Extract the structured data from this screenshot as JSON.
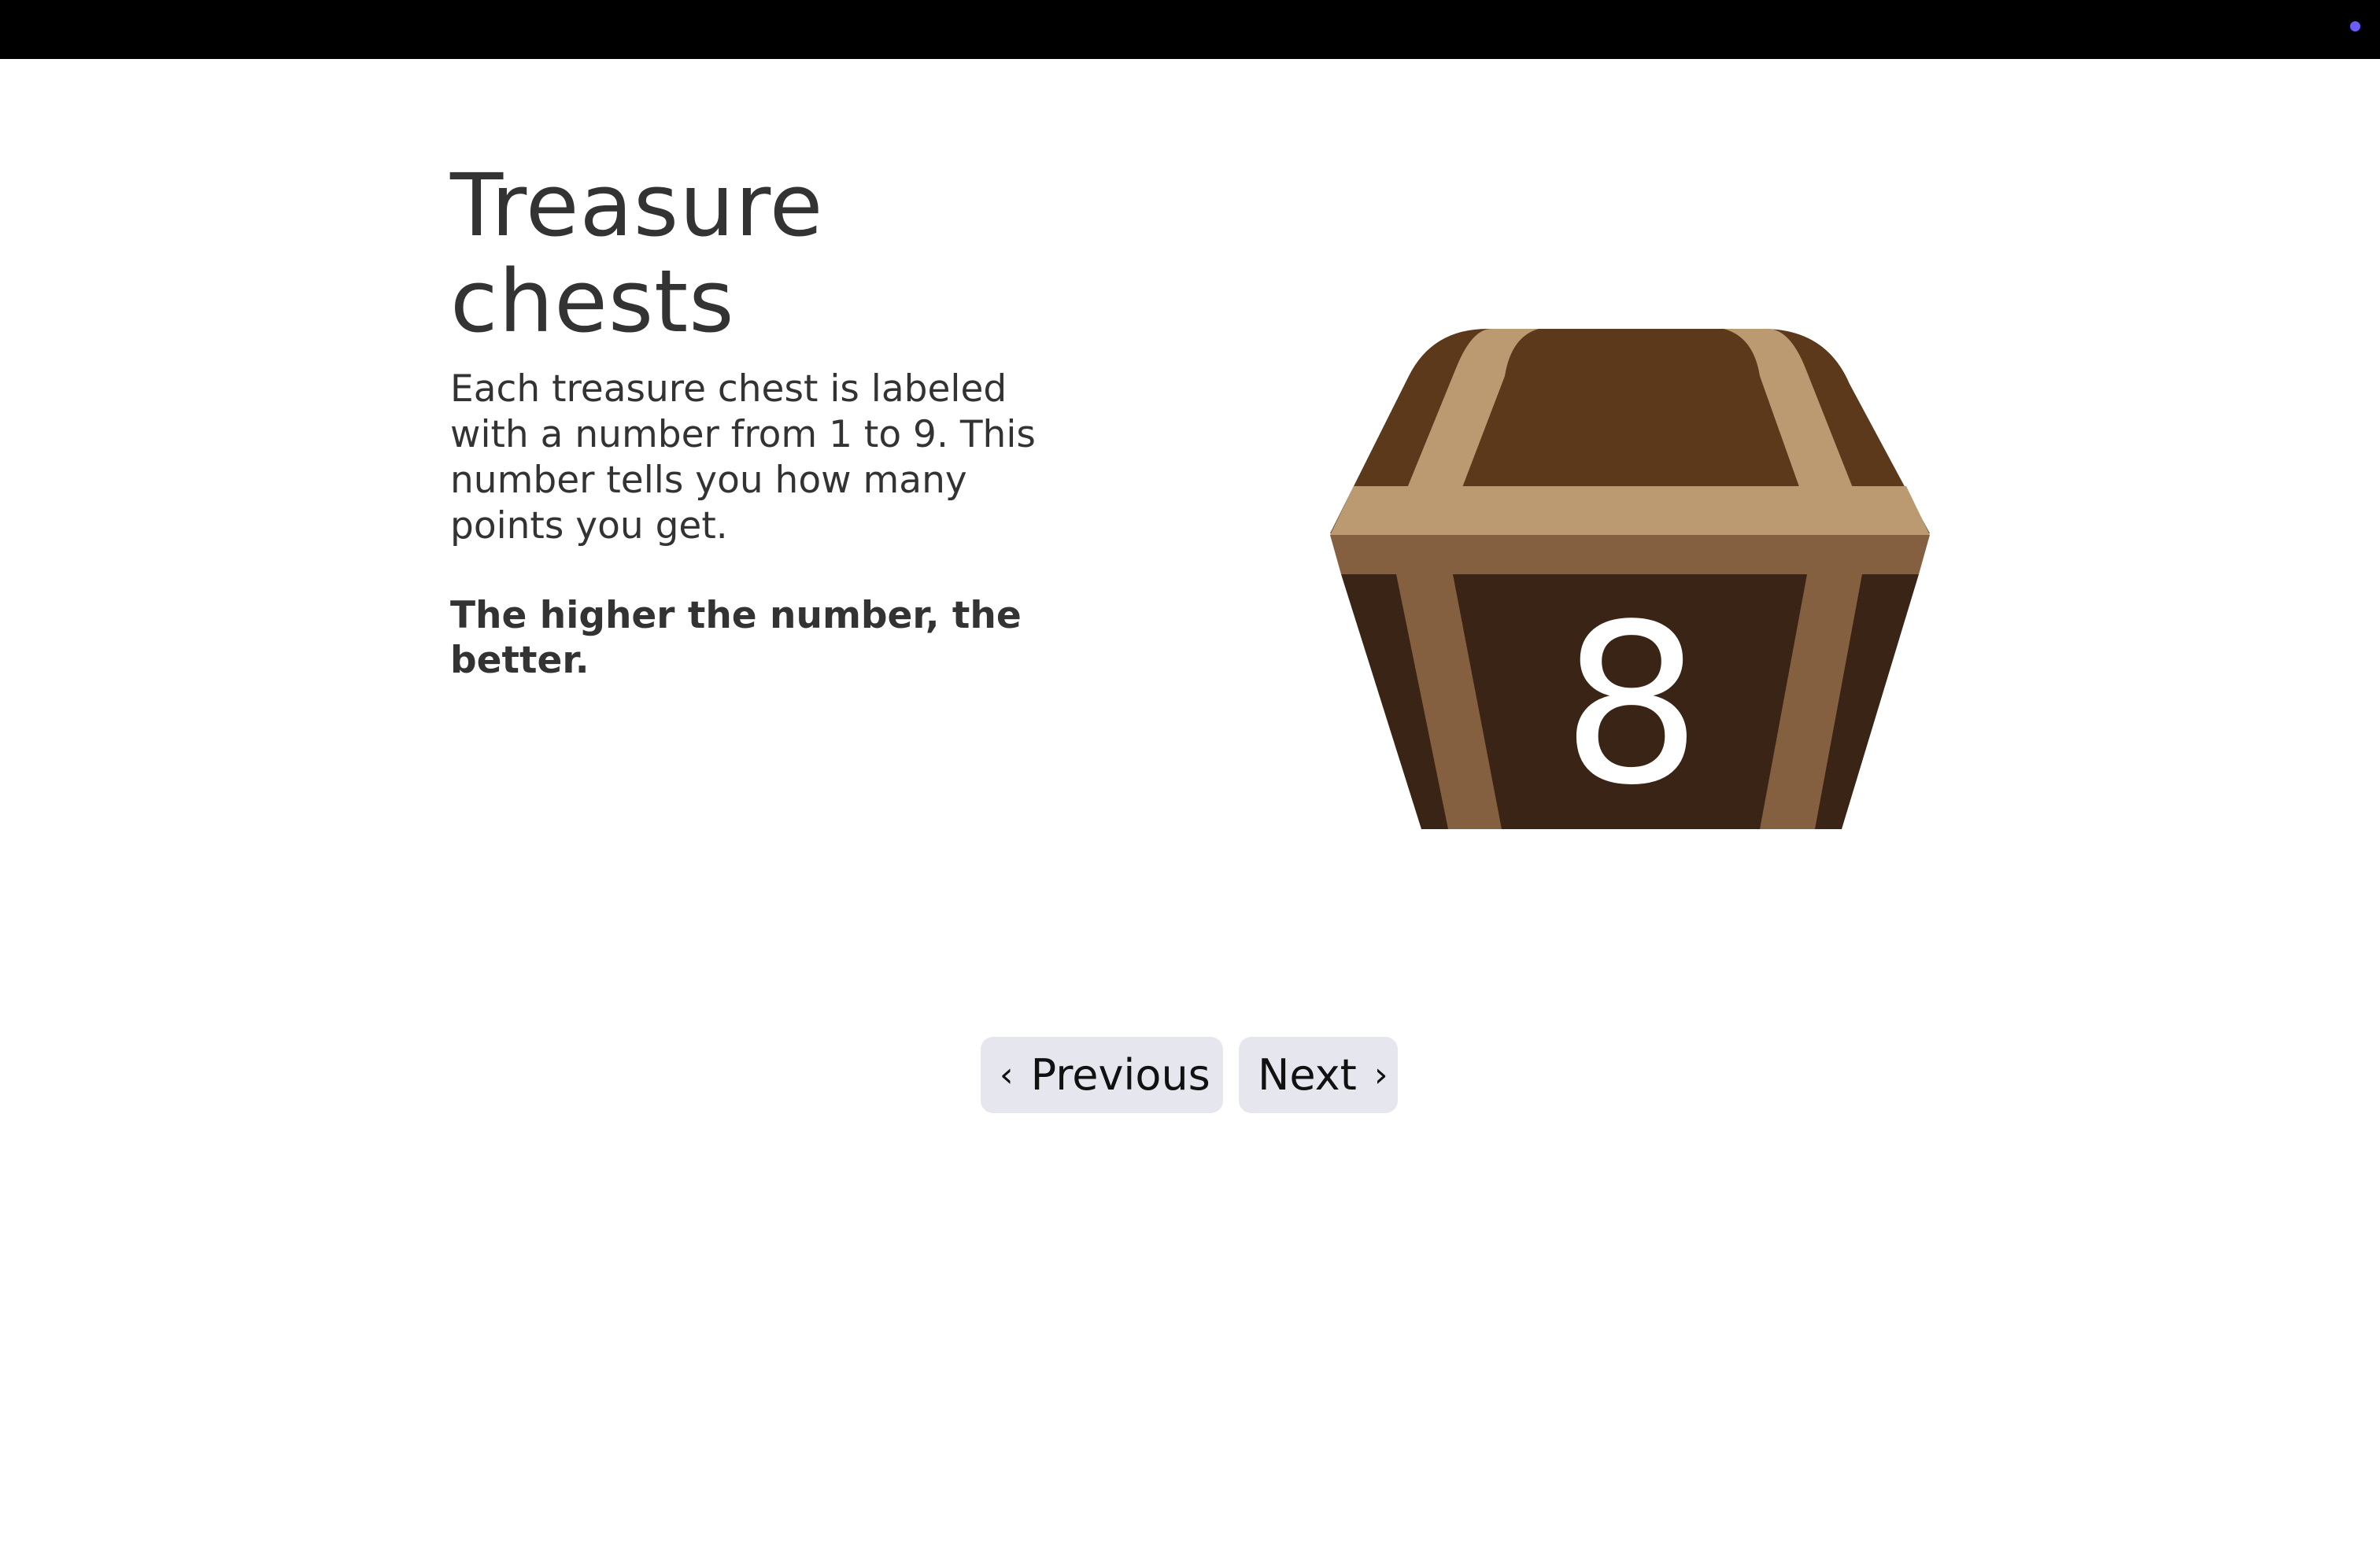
{
  "screen": {
    "title": "Treasure chests",
    "description": "Each treasure chest is labeled with a number from 1 to 9. This number tells you how many points you get.",
    "emphasis": "The higher the number, the better."
  },
  "chest": {
    "number": "8"
  },
  "navigation": {
    "previous_label": "Previous",
    "next_label": "Next",
    "previous_icon": "chevron-left-icon",
    "next_icon": "chevron-right-icon"
  },
  "colors": {
    "top_bar": "#000000",
    "status_dot": "#6a5cff",
    "text": "#333333",
    "button_background": "#e5e6ee",
    "chest_lid": "#5c391b",
    "chest_body": "#3a2416",
    "chest_band_light": "#bb9a71",
    "chest_band_dark": "#845f40"
  }
}
